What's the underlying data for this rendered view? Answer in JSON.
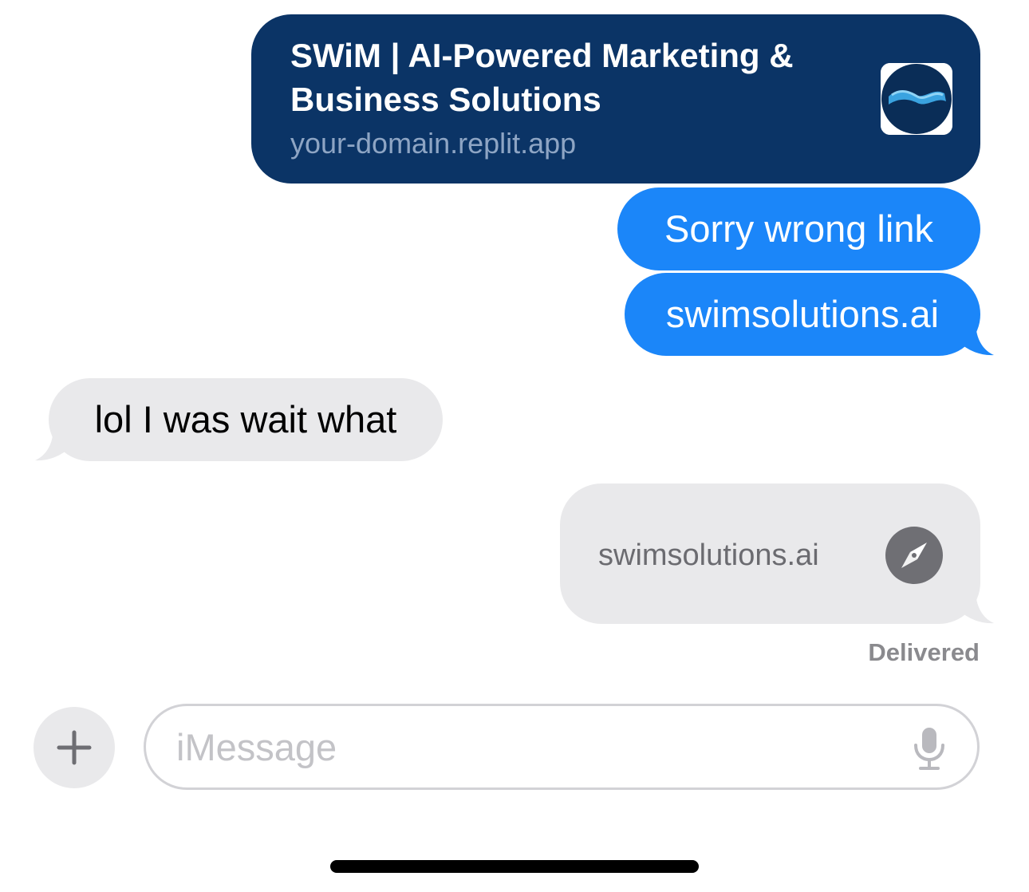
{
  "colors": {
    "sent_blue": "#1b86f9",
    "link_card_dark": "#0b3466",
    "received_gray": "#e9e9eb",
    "status_gray": "#8a8a8e"
  },
  "messages": {
    "link_preview": {
      "title": "SWiM | AI-Powered Marketing & Business Solutions",
      "domain": "your-domain.replit.app",
      "thumbnail_icon": "wave-logo-icon"
    },
    "sent_1": "Sorry wrong link",
    "sent_2": "swimsolutions.ai",
    "received_1": "lol I was wait what",
    "link_plain": {
      "text": "swimsolutions.ai",
      "icon": "compass-icon"
    },
    "status": "Delivered"
  },
  "composer": {
    "placeholder": "iMessage",
    "plus_icon": "plus-icon",
    "mic_icon": "microphone-icon"
  }
}
